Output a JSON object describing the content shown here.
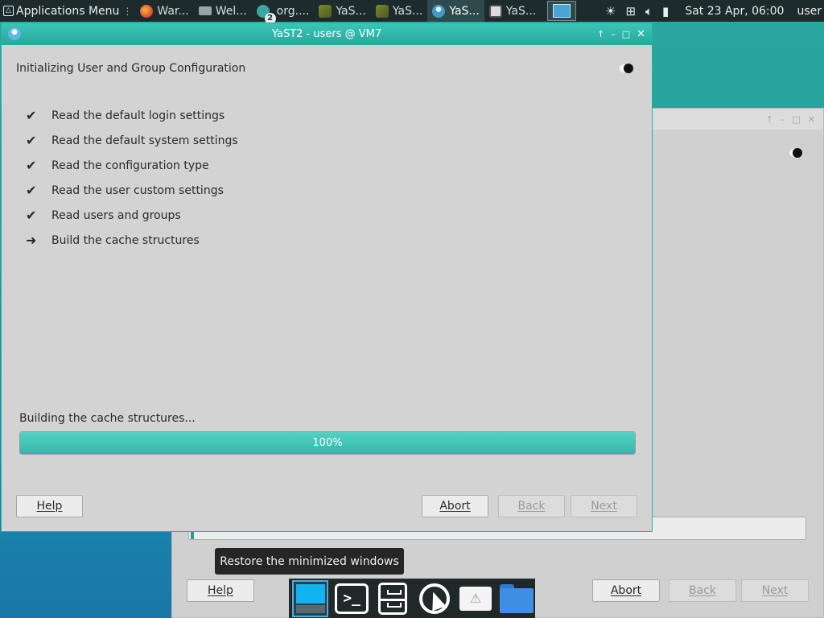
{
  "panel": {
    "apps_menu_label": "Applications Menu",
    "tasks": [
      {
        "label": "War...",
        "icon": "firefox-icon"
      },
      {
        "label": "Wel...",
        "icon": "window-icon"
      },
      {
        "label": "org....",
        "icon": "app-icon",
        "badge": "2"
      },
      {
        "label": "YaS...",
        "icon": "yast-icon"
      },
      {
        "label": "YaS...",
        "icon": "yast-icon"
      },
      {
        "label": "YaS...",
        "icon": "yast-users-icon",
        "active": true
      },
      {
        "label": "YaS...",
        "icon": "yast-monitor-icon"
      }
    ],
    "clock": "Sat 23 Apr, 06:00",
    "user": "user"
  },
  "window": {
    "title": "YaST2 - users @ VM7",
    "heading": "Initializing User and Group Configuration",
    "steps": [
      {
        "label": "Read the default login settings",
        "state": "done",
        "mark": "✔"
      },
      {
        "label": "Read the default system settings",
        "state": "done",
        "mark": "✔"
      },
      {
        "label": "Read the configuration type",
        "state": "done",
        "mark": "✔"
      },
      {
        "label": "Read the user custom settings",
        "state": "done",
        "mark": "✔"
      },
      {
        "label": "Read users and groups",
        "state": "done",
        "mark": "✔"
      },
      {
        "label": "Build the cache structures",
        "state": "current",
        "mark": "➜"
      }
    ],
    "progress_label": "Building the cache structures...",
    "progress_percent": 100,
    "progress_text": "100%",
    "buttons": {
      "help": "Help",
      "abort": "Abort",
      "back": "Back",
      "next": "Next"
    }
  },
  "background_window": {
    "buttons": {
      "help": "Help",
      "abort": "Abort",
      "back": "Back",
      "next": "Next"
    }
  },
  "tooltip": "Restore the minimized windows",
  "dock": [
    "show-desktop-icon",
    "terminal-icon",
    "file-cabinet-icon",
    "mouse-app-icon",
    "document-icon",
    "folder-icon"
  ],
  "colors": {
    "accent": "#2bb5a8",
    "panel_bg": "#1d2b2c"
  }
}
